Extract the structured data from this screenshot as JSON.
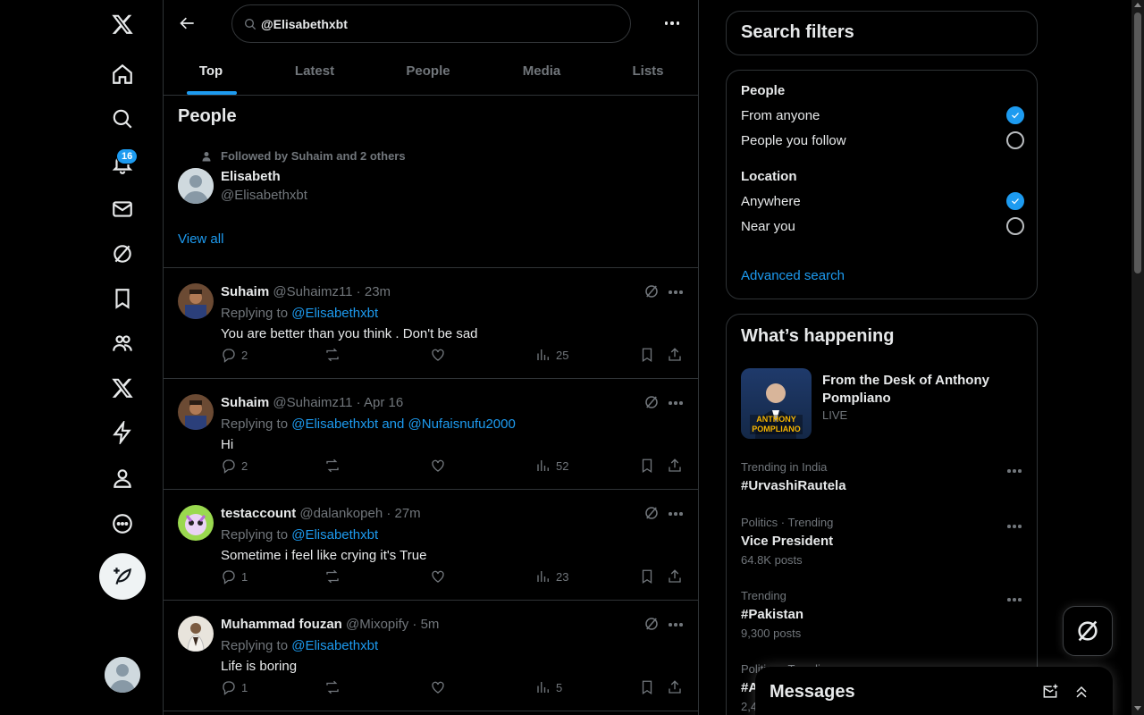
{
  "nav": {
    "notification_count": "16"
  },
  "search": {
    "query": "@Elisabethxbt"
  },
  "tabs": [
    {
      "label": "Top"
    },
    {
      "label": "Latest"
    },
    {
      "label": "People"
    },
    {
      "label": "Media"
    },
    {
      "label": "Lists"
    }
  ],
  "people": {
    "title": "People",
    "followed_by": "Followed by Suhaim and 2 others",
    "name": "Elisabeth",
    "handle": "@Elisabethxbt",
    "view_all": "View all"
  },
  "tweets": [
    {
      "name": "Suhaim",
      "meta": "@Suhaimz11 · 23m",
      "replying_prefix": "Replying to ",
      "replying_to": "@Elisabethxbt",
      "text": "You are better than you think . Don't be sad",
      "replies": "2",
      "views": "25"
    },
    {
      "name": "Suhaim",
      "meta": "@Suhaimz11 · Apr 16",
      "replying_prefix": "Replying to ",
      "replying_to": "@Elisabethxbt and @Nufaisnufu2000",
      "text": "Hi",
      "replies": "2",
      "views": "52"
    },
    {
      "name": "testaccount",
      "meta": "@dalankopeh · 27m",
      "replying_prefix": "Replying to ",
      "replying_to": "@Elisabethxbt",
      "text": "Sometime i feel like crying it's True",
      "replies": "1",
      "views": "23"
    },
    {
      "name": "Muhammad fouzan",
      "meta": "@Mixopify · 5m",
      "replying_prefix": "Replying to ",
      "replying_to": "@Elisabethxbt",
      "text": "Life is boring",
      "replies": "1",
      "views": "5"
    }
  ],
  "filters": {
    "title": "Search filters",
    "people_label": "People",
    "from_anyone": "From anyone",
    "people_you_follow": "People you follow",
    "location_label": "Location",
    "anywhere": "Anywhere",
    "near_you": "Near you",
    "advanced": "Advanced search"
  },
  "happening": {
    "title": "What’s happening",
    "live_title": "From the Desk of Anthony Pompliano",
    "live_tag": "LIVE",
    "live_thumb_text": "ANTHONY POMPLIANO",
    "trends": [
      {
        "context": "Trending in India",
        "name": "#UrvashiRautela",
        "count": ""
      },
      {
        "context": "Politics · Trending",
        "name": "Vice President",
        "count": "64.8K posts"
      },
      {
        "context": "Trending",
        "name": "#Pakistan",
        "count": "9,300 posts"
      },
      {
        "context": "Politics · Trending",
        "name": "#A",
        "count": "2,4"
      }
    ]
  },
  "messages": {
    "title": "Messages"
  },
  "colors": {
    "accent": "#1d9bf0",
    "background": "#000000",
    "border": "#2f3336",
    "muted_text": "#71767b"
  }
}
